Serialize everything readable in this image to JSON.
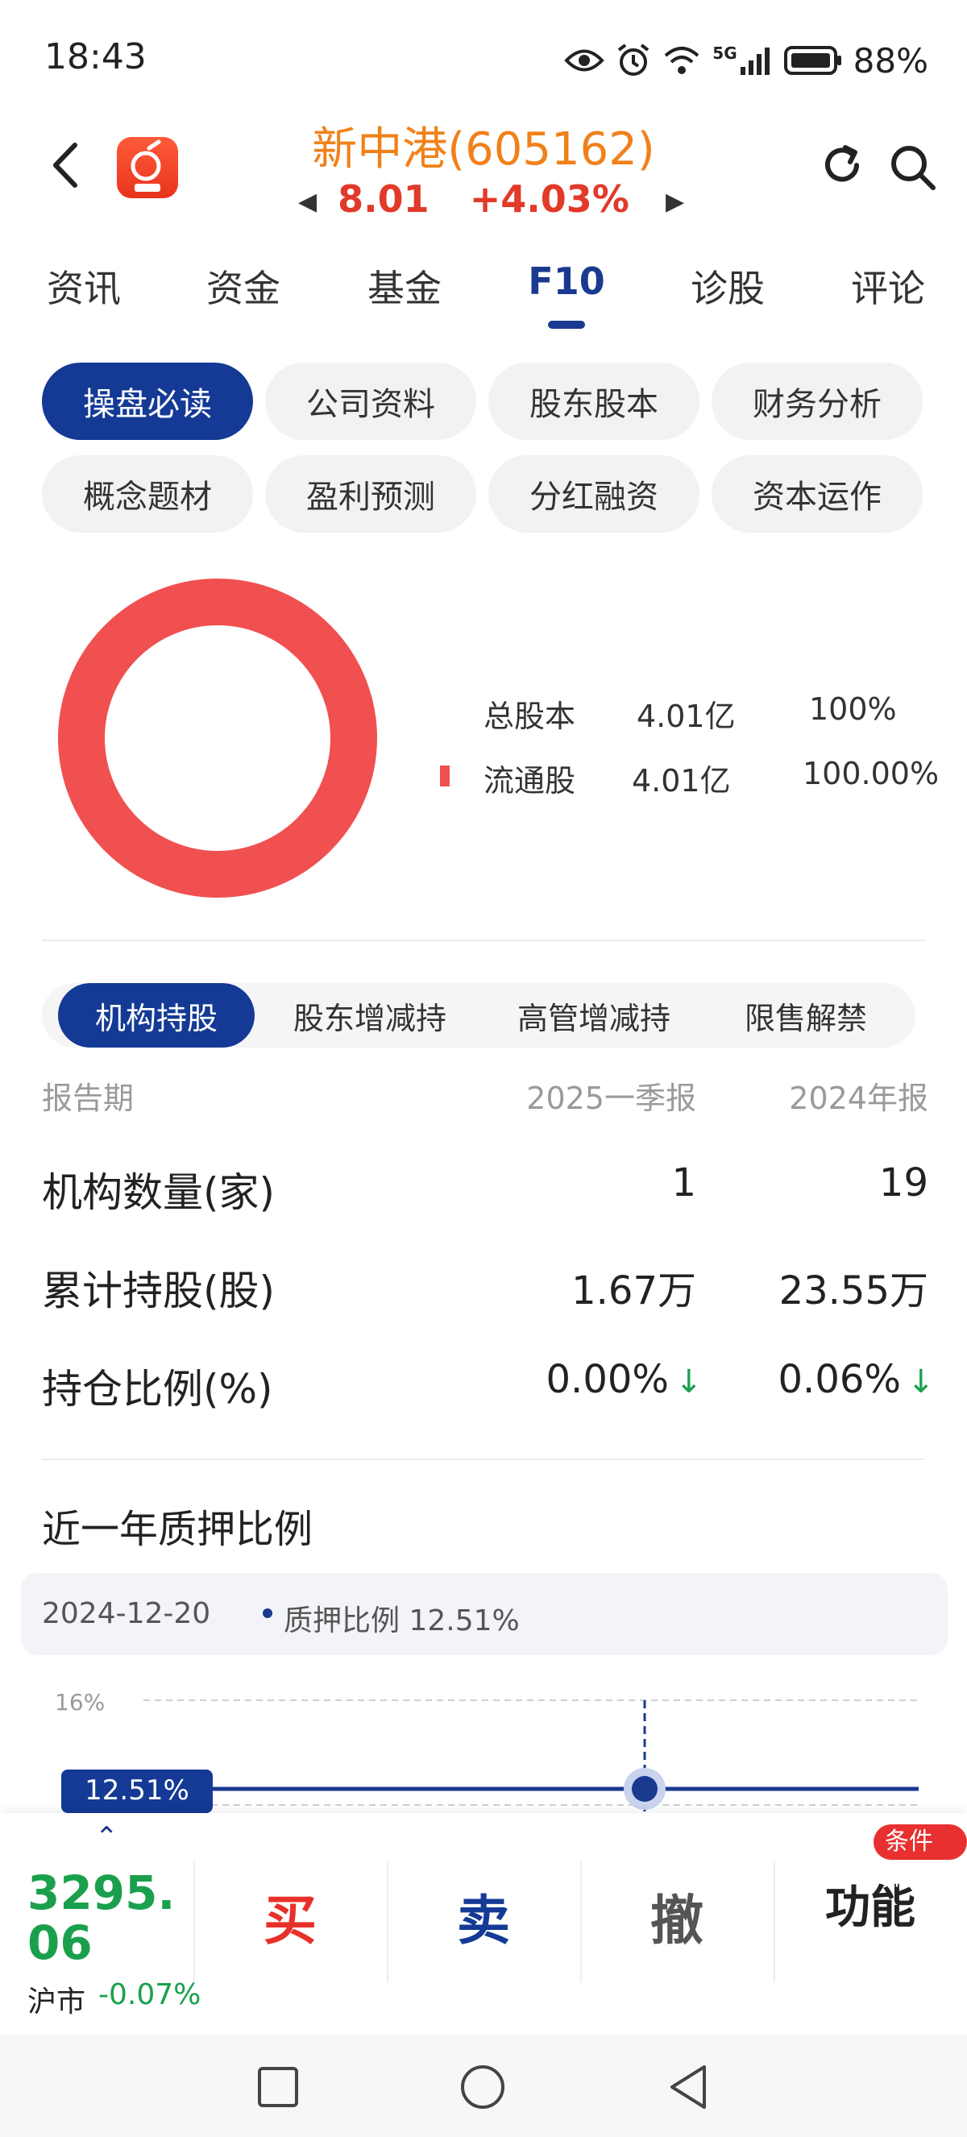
{
  "status_bar": {
    "time": "18:43",
    "network": "5G",
    "battery": "88%"
  },
  "header": {
    "stock_name": "新中港(605162)",
    "price": "8.01",
    "change": "+4.03%"
  },
  "main_tabs": [
    "资讯",
    "资金",
    "基金",
    "F10",
    "诊股",
    "评论"
  ],
  "main_tab_active": "F10",
  "sub_nav": {
    "row1": [
      "操盘必读",
      "公司资料",
      "股东股本",
      "财务分析"
    ],
    "row2": [
      "概念题材",
      "盈利预测",
      "分红融资",
      "资本运作"
    ]
  },
  "share_structure": {
    "rows": [
      {
        "label": "总股本",
        "amount": "4.01亿",
        "ratio": "100%"
      },
      {
        "label": "流通股",
        "amount": "4.01亿",
        "ratio": "100.00%"
      }
    ],
    "colors": {
      "circulating": "#f05050"
    }
  },
  "holding_tabs": [
    "机构持股",
    "股东增减持",
    "高管增减持",
    "限售解禁"
  ],
  "holding_table": {
    "header": {
      "period": "报告期",
      "col1": "2025一季报",
      "col2": "2024年报"
    },
    "rows": [
      {
        "label": "机构数量(家)",
        "v1": "1",
        "v2": "19"
      },
      {
        "label": "累计持股(股)",
        "v1": "1.67万",
        "v2": "23.55万"
      },
      {
        "label": "持仓比例(%)",
        "v1": "0.00%",
        "v2": "0.06%"
      }
    ],
    "trend_icon": "down-arrow-icon"
  },
  "pledge": {
    "title": "近一年质押比例",
    "date": "2024-12-20",
    "series_label": "质押比例 12.51%",
    "y_tick": "16%",
    "current_label": "12.51%"
  },
  "chart_data": {
    "type": "line",
    "series": [
      {
        "name": "质押比例",
        "values": [
          12.51,
          12.51,
          12.51
        ]
      }
    ],
    "highlight": {
      "x": "2024-12-20",
      "y": 12.51
    },
    "y_ticks": [
      "16%"
    ]
  },
  "trade_bar": {
    "index_value": "3295.06",
    "index_name": "沪市",
    "index_change": "-0.07%",
    "buy": "买",
    "sell": "卖",
    "cancel": "撤",
    "function": "功能",
    "badge": "条件单",
    "colors": {
      "buy": "#e8302a",
      "sell": "#143a95",
      "cancel": "#555555",
      "function": "#222222"
    }
  }
}
